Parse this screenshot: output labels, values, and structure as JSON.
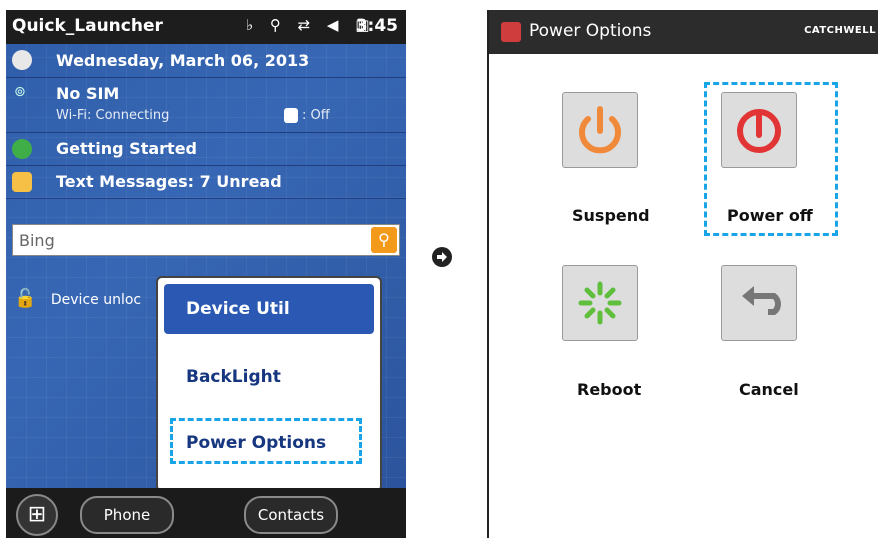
{
  "left": {
    "status": {
      "app": "Quick_Launcher",
      "time": "3:45",
      "icons": "♭ ⚲ ⇄ ◀ ▥"
    },
    "rows": [
      {
        "text": "Wednesday, March 06, 2013"
      },
      {
        "text": "No SIM",
        "sub1": "Wi-Fi: Connecting",
        "sub2": ": Off"
      },
      {
        "text": "Getting Started"
      },
      {
        "text": "Text Messages: 7 Unread"
      }
    ],
    "search": {
      "placeholder": "Bing"
    },
    "unlock": "Device unloc",
    "menu": {
      "items": [
        "Device Util",
        "BackLight",
        "Power Options"
      ]
    },
    "taskbar": {
      "phone": "Phone",
      "contacts": "Contacts"
    }
  },
  "right": {
    "title": "Power Options",
    "brand": "CATCHWELL",
    "buttons": [
      {
        "label": "Suspend"
      },
      {
        "label": "Power off"
      },
      {
        "label": "Reboot"
      },
      {
        "label": "Cancel"
      }
    ]
  }
}
